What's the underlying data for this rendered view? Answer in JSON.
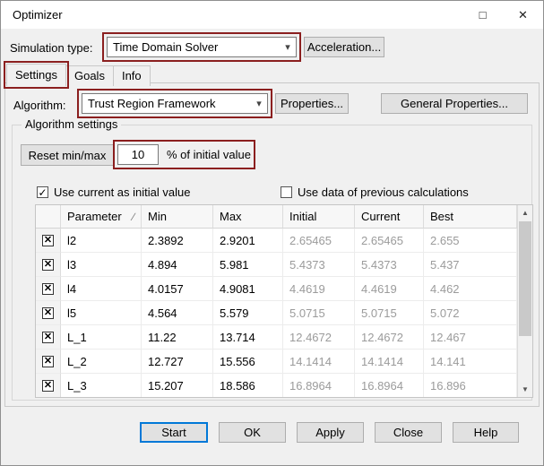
{
  "annotation_color": "#8b1f1f",
  "icons": {
    "maximize": "□",
    "close": "✕",
    "combo_arrow": "▾",
    "row_check": "✕",
    "check": "✓",
    "scroll_up": "▲",
    "scroll_down": "▼"
  },
  "window": {
    "title": "Optimizer"
  },
  "simulation": {
    "label": "Simulation type:",
    "selected": "Time Domain Solver",
    "acceleration": "Acceleration..."
  },
  "tabs": [
    {
      "label": "Settings"
    },
    {
      "label": "Goals"
    },
    {
      "label": "Info"
    }
  ],
  "algorithm": {
    "label": "Algorithm:",
    "selected": "Trust Region Framework",
    "properties": "Properties...",
    "general_properties": "General Properties..."
  },
  "settings": {
    "group_title": "Algorithm settings",
    "reset_button": "Reset min/max",
    "reset_value": "10",
    "reset_suffix": "% of initial value",
    "use_current_label": "Use current as initial value",
    "use_current_checked": true,
    "use_previous_label": "Use data of previous calculations",
    "use_previous_checked": false
  },
  "table": {
    "sort_indicator": "∕",
    "headers": [
      "",
      "Parameter",
      "Min",
      "Max",
      "Initial",
      "Current",
      "Best"
    ],
    "rows": [
      [
        "l2",
        "2.3892",
        "2.9201",
        "2.65465",
        "2.65465",
        "2.655"
      ],
      [
        "l3",
        "4.894",
        "5.981",
        "5.4373",
        "5.4373",
        "5.437"
      ],
      [
        "l4",
        "4.0157",
        "4.9081",
        "4.4619",
        "4.4619",
        "4.462"
      ],
      [
        "l5",
        "4.564",
        "5.579",
        "5.0715",
        "5.0715",
        "5.072"
      ],
      [
        "L_1",
        "11.22",
        "13.714",
        "12.4672",
        "12.4672",
        "12.467"
      ],
      [
        "L_2",
        "12.727",
        "15.556",
        "14.1414",
        "14.1414",
        "14.141"
      ],
      [
        "L_3",
        "15.207",
        "18.586",
        "16.8964",
        "16.8964",
        "16.896"
      ]
    ]
  },
  "footer": {
    "buttons": [
      "Start",
      "OK",
      "Apply",
      "Close",
      "Help"
    ]
  }
}
